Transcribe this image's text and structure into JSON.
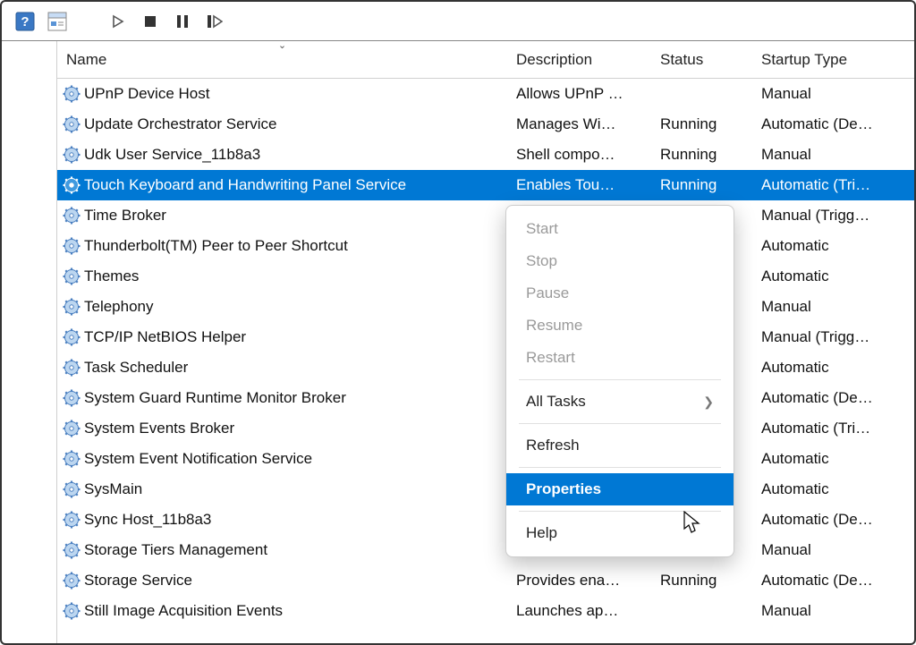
{
  "toolbar": {
    "help_icon": "help-icon",
    "props_icon": "properties-icon",
    "play_icon": "play-icon",
    "stop_icon": "stop-icon",
    "pause_icon": "pause-icon",
    "restart_icon": "restart-icon"
  },
  "columns": {
    "name": "Name",
    "description": "Description",
    "status": "Status",
    "startup": "Startup Type"
  },
  "services": [
    {
      "name": "UPnP Device Host",
      "desc": "Allows UPnP …",
      "status": "",
      "startup": "Manual",
      "selected": false
    },
    {
      "name": "Update Orchestrator Service",
      "desc": "Manages Wi…",
      "status": "Running",
      "startup": "Automatic (De…",
      "selected": false
    },
    {
      "name": "Udk User Service_11b8a3",
      "desc": "Shell compo…",
      "status": "Running",
      "startup": "Manual",
      "selected": false
    },
    {
      "name": "Touch Keyboard and Handwriting Panel Service",
      "desc": "Enables Tou…",
      "status": "Running",
      "startup": "Automatic (Tri…",
      "selected": true
    },
    {
      "name": "Time Broker",
      "desc": "",
      "status": "",
      "startup": "Manual (Trigg…",
      "selected": false
    },
    {
      "name": "Thunderbolt(TM) Peer to Peer Shortcut",
      "desc": "",
      "status": "",
      "startup": "Automatic",
      "selected": false
    },
    {
      "name": "Themes",
      "desc": "",
      "status": "",
      "startup": "Automatic",
      "selected": false
    },
    {
      "name": "Telephony",
      "desc": "",
      "status": "",
      "startup": "Manual",
      "selected": false
    },
    {
      "name": "TCP/IP NetBIOS Helper",
      "desc": "",
      "status": "",
      "startup": "Manual (Trigg…",
      "selected": false
    },
    {
      "name": "Task Scheduler",
      "desc": "",
      "status": "",
      "startup": "Automatic",
      "selected": false
    },
    {
      "name": "System Guard Runtime Monitor Broker",
      "desc": "",
      "status": "",
      "startup": "Automatic (De…",
      "selected": false
    },
    {
      "name": "System Events Broker",
      "desc": "",
      "status": "",
      "startup": "Automatic (Tri…",
      "selected": false
    },
    {
      "name": "System Event Notification Service",
      "desc": "",
      "status": "",
      "startup": "Automatic",
      "selected": false
    },
    {
      "name": "SysMain",
      "desc": "",
      "status": "",
      "startup": "Automatic",
      "selected": false
    },
    {
      "name": "Sync Host_11b8a3",
      "desc": "",
      "status": "",
      "startup": "Automatic (De…",
      "selected": false
    },
    {
      "name": "Storage Tiers Management",
      "desc": "",
      "status": "",
      "startup": "Manual",
      "selected": false
    },
    {
      "name": "Storage Service",
      "desc": "Provides ena…",
      "status": "Running",
      "startup": "Automatic (De…",
      "selected": false
    },
    {
      "name": "Still Image Acquisition Events",
      "desc": "Launches ap…",
      "status": "",
      "startup": "Manual",
      "selected": false
    }
  ],
  "context_menu": {
    "items": [
      {
        "label": "Start",
        "disabled": true,
        "submenu": false,
        "separator_after": false
      },
      {
        "label": "Stop",
        "disabled": true,
        "submenu": false,
        "separator_after": false
      },
      {
        "label": "Pause",
        "disabled": true,
        "submenu": false,
        "separator_after": false
      },
      {
        "label": "Resume",
        "disabled": true,
        "submenu": false,
        "separator_after": false
      },
      {
        "label": "Restart",
        "disabled": true,
        "submenu": false,
        "separator_after": true
      },
      {
        "label": "All Tasks",
        "disabled": false,
        "submenu": true,
        "separator_after": true
      },
      {
        "label": "Refresh",
        "disabled": false,
        "submenu": false,
        "separator_after": true
      },
      {
        "label": "Properties",
        "disabled": false,
        "submenu": false,
        "separator_after": true,
        "selected": true
      },
      {
        "label": "Help",
        "disabled": false,
        "submenu": false,
        "separator_after": false
      }
    ]
  }
}
